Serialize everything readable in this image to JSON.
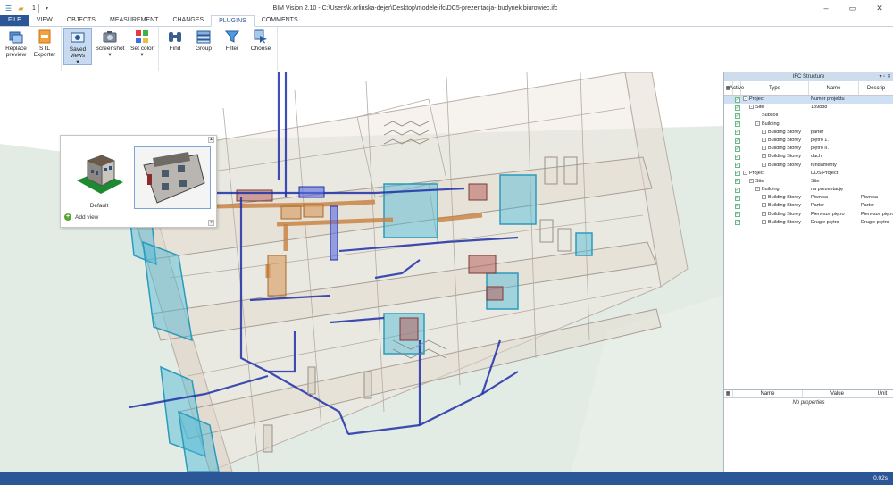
{
  "app": {
    "title": "BIM Vision 2.10 - C:\\Users\\k.orlinska-dejer\\Desktop\\modele ifc\\DC5-prezentacja- budynek biurowiec.ifc",
    "qat_spin_value": "1",
    "window_controls": [
      "–",
      "▭",
      "✕"
    ]
  },
  "tabs": [
    {
      "label": "FILE"
    },
    {
      "label": "VIEW"
    },
    {
      "label": "OBJECTS"
    },
    {
      "label": "MEASUREMENT"
    },
    {
      "label": "CHANGES"
    },
    {
      "label": "PLUGINS",
      "active": true
    },
    {
      "label": "COMMENTS"
    }
  ],
  "ribbon": {
    "replace_preview": "Replace preview",
    "stl_exporter": "STL Exporter",
    "saved_views": "Saved views",
    "screenshot": "Screenshot",
    "set_color": "Set color",
    "find": "Find",
    "group": "Group",
    "filter": "Filter",
    "choose": "Choose",
    "dropdown_arrow": "▾"
  },
  "saved_views_popup": {
    "default_label": "Default",
    "add_view": "Add view"
  },
  "ifc_panel": {
    "title": "IFC Structure",
    "columns": {
      "active": "Active",
      "type": "Type",
      "name": "Name",
      "description": "Descrip"
    },
    "rows": [
      {
        "type": "Project",
        "name": "Numer projektu",
        "desc": "",
        "indent": 0,
        "exp": "-",
        "selected": true
      },
      {
        "type": "Site",
        "name": "139888",
        "desc": "",
        "indent": 1,
        "exp": "-"
      },
      {
        "type": "Subsoil",
        "name": "",
        "desc": "",
        "indent": 2,
        "exp": ""
      },
      {
        "type": "Building",
        "name": "",
        "desc": "",
        "indent": 2,
        "exp": "-"
      },
      {
        "type": "Building Storey",
        "name": "parter",
        "desc": "",
        "indent": 3,
        "exp": "+"
      },
      {
        "type": "Building Storey",
        "name": "piętro 1.",
        "desc": "",
        "indent": 3,
        "exp": "+"
      },
      {
        "type": "Building Storey",
        "name": "piętro II.",
        "desc": "",
        "indent": 3,
        "exp": "+"
      },
      {
        "type": "Building Storey",
        "name": "dach",
        "desc": "",
        "indent": 3,
        "exp": "+"
      },
      {
        "type": "Building Storey",
        "name": "fundamenty",
        "desc": "",
        "indent": 3,
        "exp": "+"
      },
      {
        "type": "Project",
        "name": "DDS Project",
        "desc": "",
        "indent": 0,
        "exp": "-"
      },
      {
        "type": "Site",
        "name": "Site",
        "desc": "",
        "indent": 1,
        "exp": "-"
      },
      {
        "type": "Building",
        "name": "na prezentację",
        "desc": "",
        "indent": 2,
        "exp": "-"
      },
      {
        "type": "Building Storey",
        "name": "Piwnica",
        "desc": "Piwnica",
        "indent": 3,
        "exp": "+"
      },
      {
        "type": "Building Storey",
        "name": "Parter",
        "desc": "Parter",
        "indent": 3,
        "exp": "+"
      },
      {
        "type": "Building Storey",
        "name": "Pierwsze piętro",
        "desc": "Pierwsze piętro",
        "indent": 3,
        "exp": "+"
      },
      {
        "type": "Building Storey",
        "name": "Drugie piętro",
        "desc": "Drugie piętro",
        "indent": 3,
        "exp": "+"
      }
    ]
  },
  "properties_panel": {
    "columns": {
      "name": "Name",
      "value": "Value",
      "unit": "Unit"
    },
    "empty_text": "No properties"
  },
  "status": {
    "fps": "0.02s"
  },
  "colors": {
    "accent": "#2b5797",
    "duct_blue": "#1f2fa8",
    "glass_cyan": "#49b8d6",
    "pipe_orange": "#c8803f",
    "ground": "#e3ece4"
  }
}
